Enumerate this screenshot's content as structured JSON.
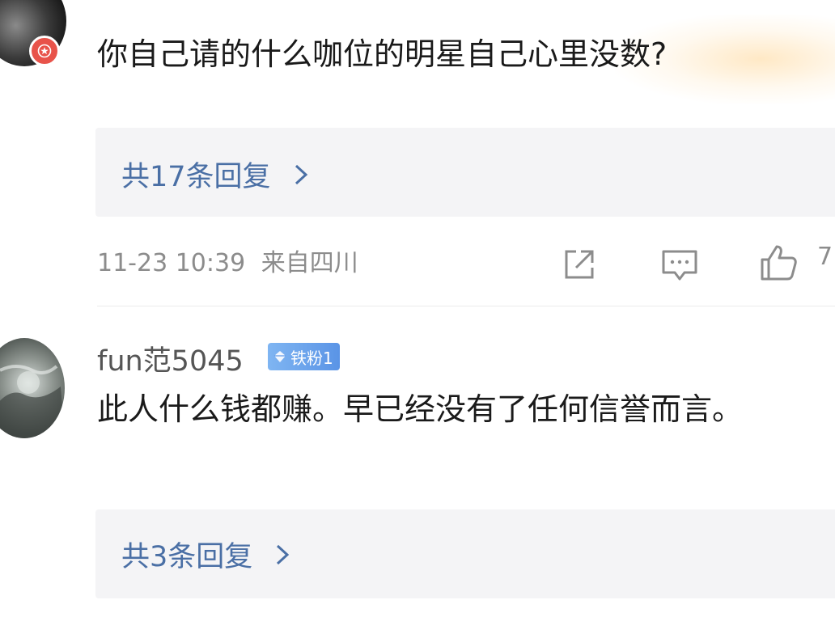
{
  "comment1": {
    "username": "",
    "text": "你自己请的什么咖位的明星自己心里没数?",
    "reply_count_label": "共17条回复",
    "timestamp": "11-23 10:39",
    "location": "来自四川",
    "like_count": "7"
  },
  "comment2": {
    "username": "fun范5045",
    "fan_badge": "铁粉1",
    "text": "此人什么钱都赚。早已经没有了任何信誉而言。",
    "reply_count_label": "共3条回复"
  },
  "colors": {
    "link": "#4a6fa5",
    "meta": "#8c8c8c",
    "vip_badge": "#e8534a",
    "fan_badge": "#5a94e6"
  },
  "icons": [
    "share-icon",
    "comment-icon",
    "like-icon",
    "chevron-right-icon",
    "vip-star-icon",
    "diamond-icon"
  ]
}
